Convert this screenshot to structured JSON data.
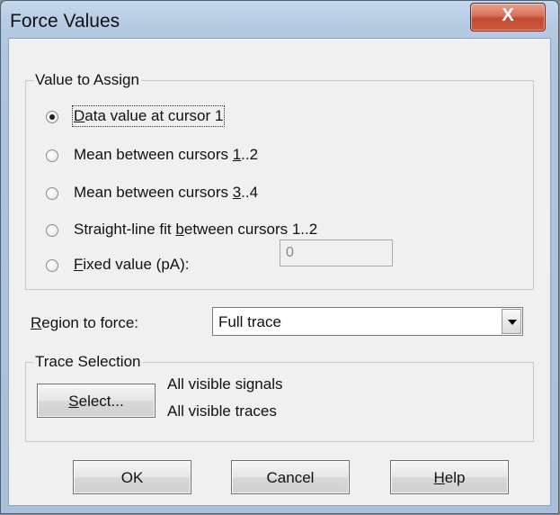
{
  "window": {
    "title": "Force Values",
    "close_glyph": "X"
  },
  "value_group": {
    "label": "Value to Assign",
    "options": [
      {
        "mnemonic": "D",
        "rest": "ata value at cursor 1",
        "checked": true
      },
      {
        "before": "Mean between cursors ",
        "mnemonic": "1",
        "after": "..2",
        "checked": false
      },
      {
        "before": "Mean between cursors ",
        "mnemonic": "3",
        "after": "..4",
        "checked": false
      },
      {
        "before": "Straight-line fit ",
        "mnemonic": "b",
        "after": "etween cursors 1..2",
        "checked": false
      },
      {
        "mnemonic": "F",
        "rest": "ixed value (pA):",
        "checked": false
      }
    ],
    "fixed_value": "0"
  },
  "region": {
    "label_mnemonic": "R",
    "label_rest": "egion to force:",
    "selected": "Full trace",
    "arrow_icon": "chevron-down-icon"
  },
  "trace_group": {
    "label": "Trace Selection",
    "select_button_mnemonic": "S",
    "select_button_rest": "elect...",
    "line1": "All visible signals",
    "line2": "All visible traces"
  },
  "buttons": {
    "ok": "OK",
    "cancel": "Cancel",
    "help_mnemonic": "H",
    "help_rest": "elp"
  }
}
